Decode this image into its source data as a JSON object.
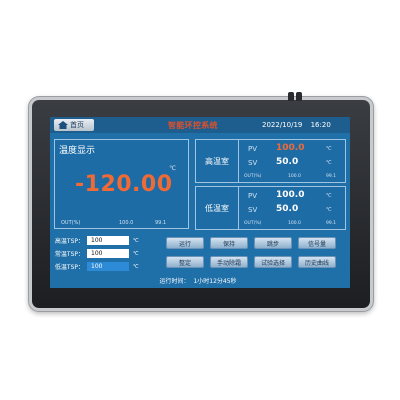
{
  "header": {
    "home_label": "首页",
    "title": "智能环控系统",
    "date": "2022/10/19",
    "time": "16:20"
  },
  "main_panel": {
    "title": "温度显示",
    "unit": "℃",
    "value": "-120.00",
    "out_label": "OUT(%)",
    "out_value_1": "100.0",
    "out_value_2": "99.1"
  },
  "rooms": [
    {
      "name": "高温室",
      "pv_label": "PV",
      "pv_value": "100.0",
      "pv_unit": "℃",
      "sv_label": "SV",
      "sv_value": "50.0",
      "sv_unit": "℃",
      "out_label": "OUT(%)",
      "out_value_1": "100.0",
      "out_value_2": "99.1",
      "pv_color": "#f06a36"
    },
    {
      "name": "低温室",
      "pv_label": "PV",
      "pv_value": "100.0",
      "pv_unit": "℃",
      "sv_label": "SV",
      "sv_value": "50.0",
      "sv_unit": "℃",
      "out_label": "OUT(%)",
      "out_value_1": "100.0",
      "out_value_2": "99.1",
      "pv_color": "#ffffff"
    }
  ],
  "setpoints": [
    {
      "label": "高温TSP：",
      "value": "100",
      "unit": "℃"
    },
    {
      "label": "常温TSP：",
      "value": "100",
      "unit": "℃"
    },
    {
      "label": "低温TSP：",
      "value": "100",
      "unit": "℃"
    }
  ],
  "buttons": {
    "run": "运行",
    "hold": "保持",
    "skip": "跳步",
    "signal": "信号量",
    "settings": "整定",
    "defrost": "手动除霜",
    "test": "试验选择",
    "history": "历史曲线"
  },
  "status": {
    "label": "运行时间：",
    "value": "1小时12分45秒"
  },
  "colors": {
    "screen_bg": "#1f6fa8",
    "accent": "#f06a36",
    "title": "#e0502a"
  }
}
